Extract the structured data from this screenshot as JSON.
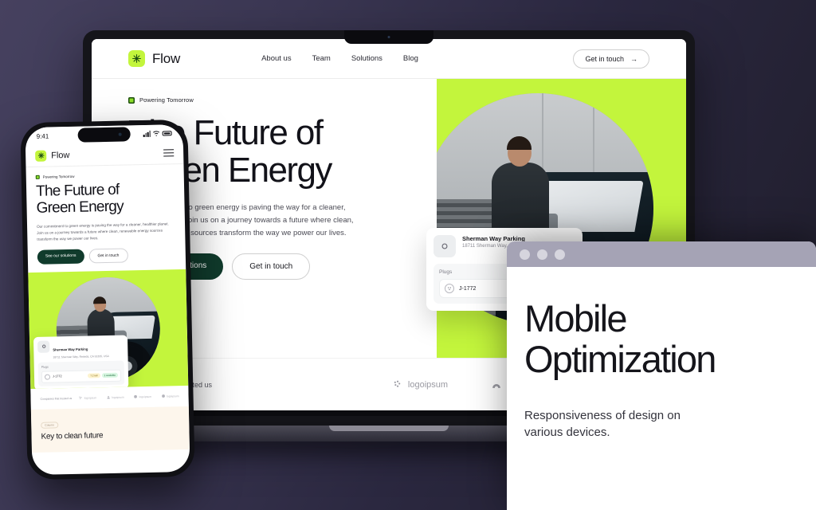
{
  "background": {
    "gradient_from": "#46415f",
    "gradient_to": "#1e1c29"
  },
  "accent": {
    "lime": "#c3f53c",
    "dark_green": "#103b2c",
    "cream": "#fdf6ec"
  },
  "laptop": {
    "nav": {
      "brand": "Flow",
      "brand_icon": "sun-burst-icon",
      "links": [
        "About us",
        "Team",
        "Solutions",
        "Blog"
      ],
      "cta": "Get in touch",
      "cta_arrow": "→"
    },
    "hero": {
      "eyebrow": "Powering Tomorrow",
      "heading_line1": "The Future of",
      "heading_line2": "Green Energy",
      "paragraph": "Our commitment to green energy is paving the way for a cleaner, healthier planet. Join us on a journey towards a future where clean, renewable energy sources transform the way we power our lives.",
      "btn_primary": "See our solutions",
      "btn_secondary": "Get in touch"
    },
    "parking_card": {
      "thumb_icon": "charger-photo-icon",
      "title": "Sherman Way Parking",
      "address": "18711 Sherman Way, Reseda, CA 91335, USA",
      "section_label": "Plugs",
      "plug_icon": "plug-socket-icon",
      "plug_name": "J-1772",
      "pill_power": "7.2 kW",
      "pill_status": "1 available"
    },
    "trusted": {
      "label": "Companies that trusted us",
      "logos": [
        {
          "name": "logoipsum",
          "icon": "dots-cluster-icon"
        },
        {
          "name": "Logoipsum",
          "icon": "arch-icon"
        },
        {
          "name": "logoipsum",
          "icon": "circle-icon"
        }
      ]
    }
  },
  "phone": {
    "status": {
      "time": "9:41",
      "signal_icon": "cellular-bars-icon",
      "wifi_icon": "wifi-icon",
      "battery_icon": "battery-icon"
    },
    "nav": {
      "brand": "Flow",
      "brand_icon": "sun-burst-icon",
      "menu_icon": "hamburger-menu-icon"
    },
    "hero": {
      "eyebrow": "Powering Tomorrow",
      "heading_line1": "The Future of",
      "heading_line2": "Green Energy",
      "paragraph": "Our commitment to green energy is paving the way for a cleaner, healthier planet. Join us on a journey towards a future where clean, renewable energy sources transform the way we power our lives.",
      "btn_primary": "See our solutions",
      "btn_secondary": "Get in touch"
    },
    "parking_card": {
      "title": "Sherman Way Parking",
      "address": "18711 Sherman Way, Reseda, CA 91335, USA",
      "section_label": "Plugs",
      "plug_name": "J-1772",
      "pill_power": "7.2 kW",
      "pill_status": "1 available"
    },
    "trusted": {
      "label": "Companies that trusted us",
      "logos": [
        {
          "name": "logoipsum"
        },
        {
          "name": "logoipsum"
        },
        {
          "name": "logoipsum"
        },
        {
          "name": "logoipsum"
        }
      ]
    },
    "footer": {
      "tag": "Column",
      "heading": "Key to clean future"
    }
  },
  "browser": {
    "dots": [
      "close-dot",
      "minimize-dot",
      "maximize-dot"
    ],
    "heading_line1": "Mobile",
    "heading_line2": "Optimization",
    "paragraph_line1": "Responsiveness of design on",
    "paragraph_line2": "various devices."
  }
}
